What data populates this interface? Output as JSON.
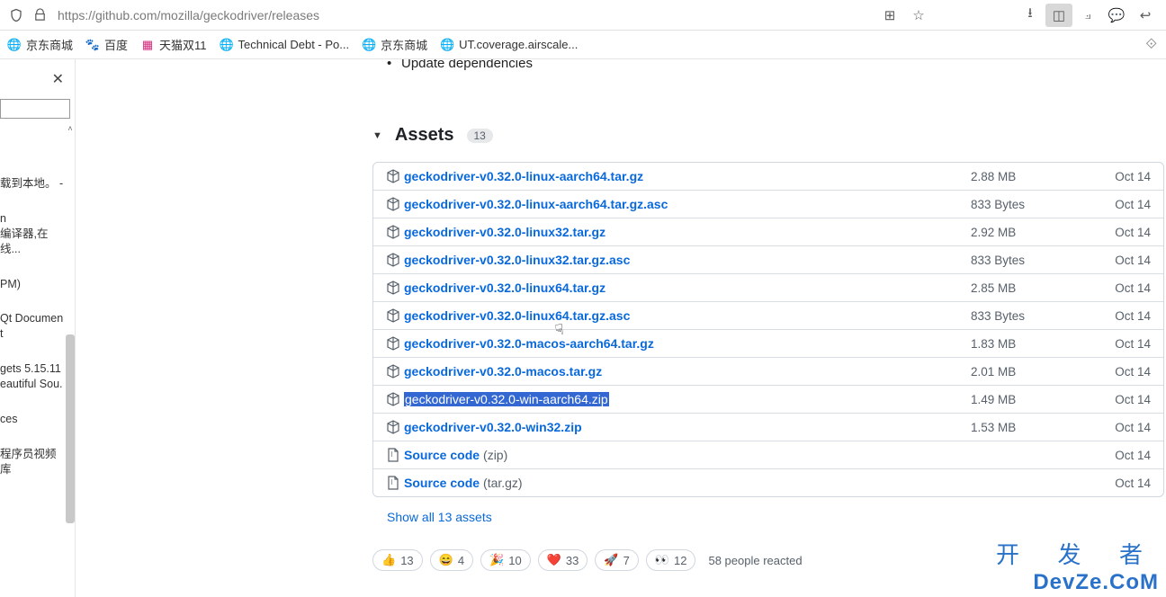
{
  "urlbar": {
    "url": "https://github.com/mozilla/geckodriver/releases"
  },
  "bookmarks": [
    {
      "icon": "globe",
      "label": "京东商城"
    },
    {
      "icon": "baidu",
      "label": "百度"
    },
    {
      "icon": "tmall",
      "label": "天猫双11"
    },
    {
      "icon": "globe",
      "label": "Technical Debt - Po..."
    },
    {
      "icon": "globe",
      "label": "京东商城"
    },
    {
      "icon": "globe",
      "label": "UT.coverage.airscale..."
    }
  ],
  "sidebar": {
    "entries": [
      "载到本地。 -",
      "n\n编译器,在线...",
      "PM)",
      "Qt Document",
      "gets 5.15.11\neautiful Sou.",
      "ces",
      "程序员视频库"
    ]
  },
  "release": {
    "update_line": "Update dependencies",
    "assets_label": "Assets",
    "assets_count": "13",
    "show_all": "Show all 13 assets",
    "reacted_text": "58 people reacted",
    "assets": [
      {
        "name": "geckodriver-v0.32.0-linux-aarch64.tar.gz",
        "size": "2.88 MB",
        "date": "Oct 14",
        "type": "pkg"
      },
      {
        "name": "geckodriver-v0.32.0-linux-aarch64.tar.gz.asc",
        "size": "833 Bytes",
        "date": "Oct 14",
        "type": "pkg"
      },
      {
        "name": "geckodriver-v0.32.0-linux32.tar.gz",
        "size": "2.92 MB",
        "date": "Oct 14",
        "type": "pkg"
      },
      {
        "name": "geckodriver-v0.32.0-linux32.tar.gz.asc",
        "size": "833 Bytes",
        "date": "Oct 14",
        "type": "pkg"
      },
      {
        "name": "geckodriver-v0.32.0-linux64.tar.gz",
        "size": "2.85 MB",
        "date": "Oct 14",
        "type": "pkg"
      },
      {
        "name": "geckodriver-v0.32.0-linux64.tar.gz.asc",
        "size": "833 Bytes",
        "date": "Oct 14",
        "type": "pkg"
      },
      {
        "name": "geckodriver-v0.32.0-macos-aarch64.tar.gz",
        "size": "1.83 MB",
        "date": "Oct 14",
        "type": "pkg"
      },
      {
        "name": "geckodriver-v0.32.0-macos.tar.gz",
        "size": "2.01 MB",
        "date": "Oct 14",
        "type": "pkg"
      },
      {
        "name": "geckodriver-v0.32.0-win-aarch64.zip",
        "size": "1.49 MB",
        "date": "Oct 14",
        "type": "pkg",
        "selected": true
      },
      {
        "name": "geckodriver-v0.32.0-win32.zip",
        "size": "1.53 MB",
        "date": "Oct 14",
        "type": "pkg"
      },
      {
        "name": "Source code",
        "suffix": "(zip)",
        "size": "",
        "date": "Oct 14",
        "type": "zip"
      },
      {
        "name": "Source code",
        "suffix": "(tar.gz)",
        "size": "",
        "date": "Oct 14",
        "type": "zip"
      }
    ],
    "reactions": [
      {
        "emoji": "👍",
        "count": "13"
      },
      {
        "emoji": "😄",
        "count": "4"
      },
      {
        "emoji": "🎉",
        "count": "10"
      },
      {
        "emoji": "❤️",
        "count": "33"
      },
      {
        "emoji": "🚀",
        "count": "7"
      },
      {
        "emoji": "👀",
        "count": "12"
      }
    ]
  },
  "watermark": {
    "l1": "开 发 者",
    "l2": "DevZe.CoM"
  }
}
